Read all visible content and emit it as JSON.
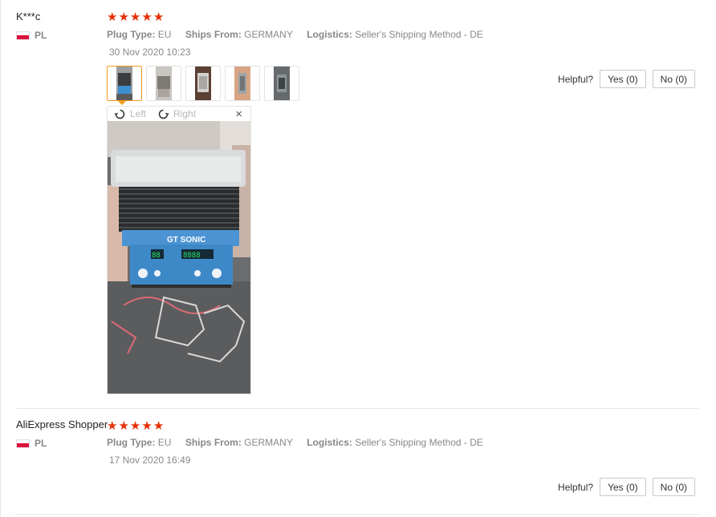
{
  "reviews": [
    {
      "user": "K***c",
      "country": "PL",
      "rating": 5,
      "plug_type_label": "Plug Type:",
      "plug_type": "EU",
      "ships_from_label": "Ships From:",
      "ships_from": "GERMANY",
      "logistics_label": "Logistics:",
      "logistics": "Seller's Shipping Method - DE",
      "date": "30 Nov 2020 10:23",
      "helpful_label": "Helpful?",
      "yes_label": "Yes (0)",
      "no_label": "No (0)",
      "viewer": {
        "rotate_left": "Left",
        "rotate_right": "Right",
        "close": "×",
        "photo_text_brand": "GT SONIC",
        "photo_display_left": "88",
        "photo_display_right": "8888"
      }
    },
    {
      "user": "AliExpress Shopper",
      "country": "PL",
      "rating": 5,
      "plug_type_label": "Plug Type:",
      "plug_type": "EU",
      "ships_from_label": "Ships From:",
      "ships_from": "GERMANY",
      "logistics_label": "Logistics:",
      "logistics": "Seller's Shipping Method - DE",
      "date": "17 Nov 2020 16:49",
      "helpful_label": "Helpful?",
      "yes_label": "Yes (0)",
      "no_label": "No (0)"
    }
  ],
  "colors": {
    "star": "#e62e04",
    "active_thumb_border": "#f49a1d",
    "muted_text": "#888888"
  }
}
